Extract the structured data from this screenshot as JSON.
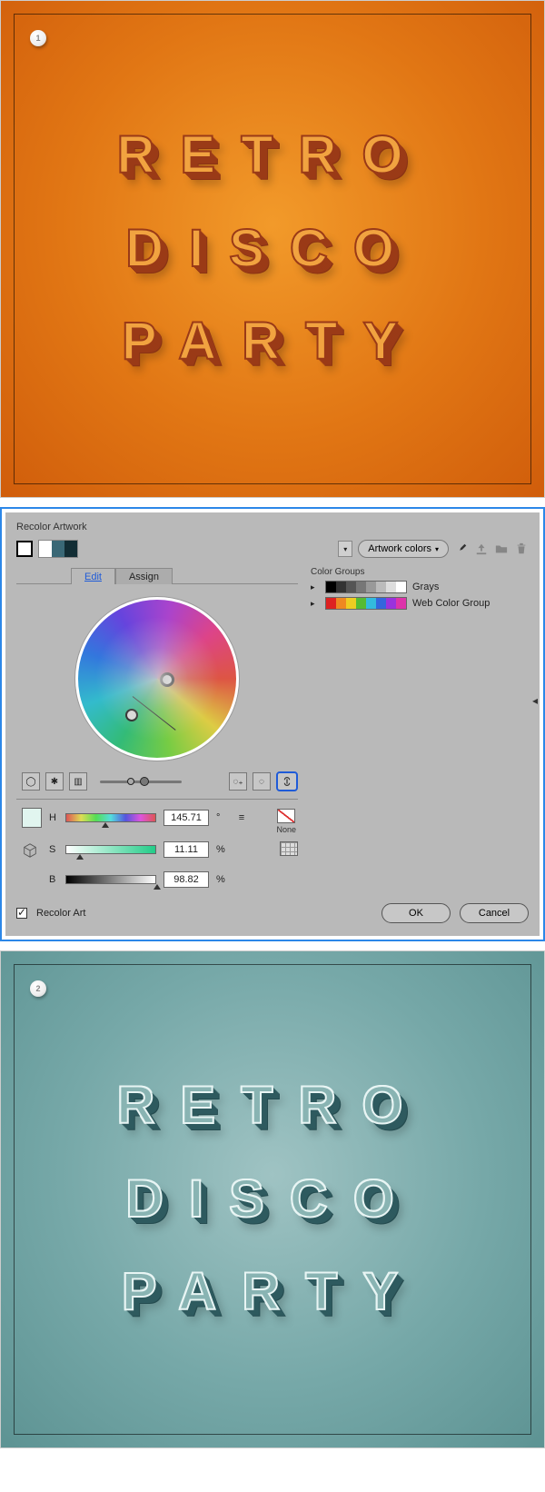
{
  "posters": {
    "line1": "RETRO",
    "line2": "DISCO",
    "line3": "PARTY",
    "step1_badge": "1",
    "step2_badge": "2"
  },
  "dialog": {
    "title": "Recolor Artwork",
    "colorset_label": "Artwork colors",
    "active_swatches": [
      "#ffffff",
      "#3a6876",
      "#122d34"
    ],
    "tabs": {
      "edit": "Edit",
      "assign": "Assign"
    },
    "hsb": {
      "h": {
        "label": "H",
        "value": "145.71",
        "unit": "°"
      },
      "s": {
        "label": "S",
        "value": "11.11",
        "unit": "%"
      },
      "b": {
        "label": "B",
        "value": "98.82",
        "unit": "%"
      },
      "preview_color": "#e1f5ef"
    },
    "none_label": "None",
    "color_groups_title": "Color Groups",
    "groups": {
      "grays": {
        "label": "Grays",
        "swatches": [
          "#000000",
          "#333333",
          "#555555",
          "#777777",
          "#999999",
          "#bbbbbb",
          "#dddddd",
          "#ffffff"
        ]
      },
      "web": {
        "label": "Web Color Group",
        "swatches": [
          "#d22",
          "#e82",
          "#ec2",
          "#5b3",
          "#3bd",
          "#36d",
          "#93d",
          "#d3a"
        ]
      }
    },
    "recolor_art": "Recolor Art",
    "ok": "OK",
    "cancel": "Cancel"
  }
}
